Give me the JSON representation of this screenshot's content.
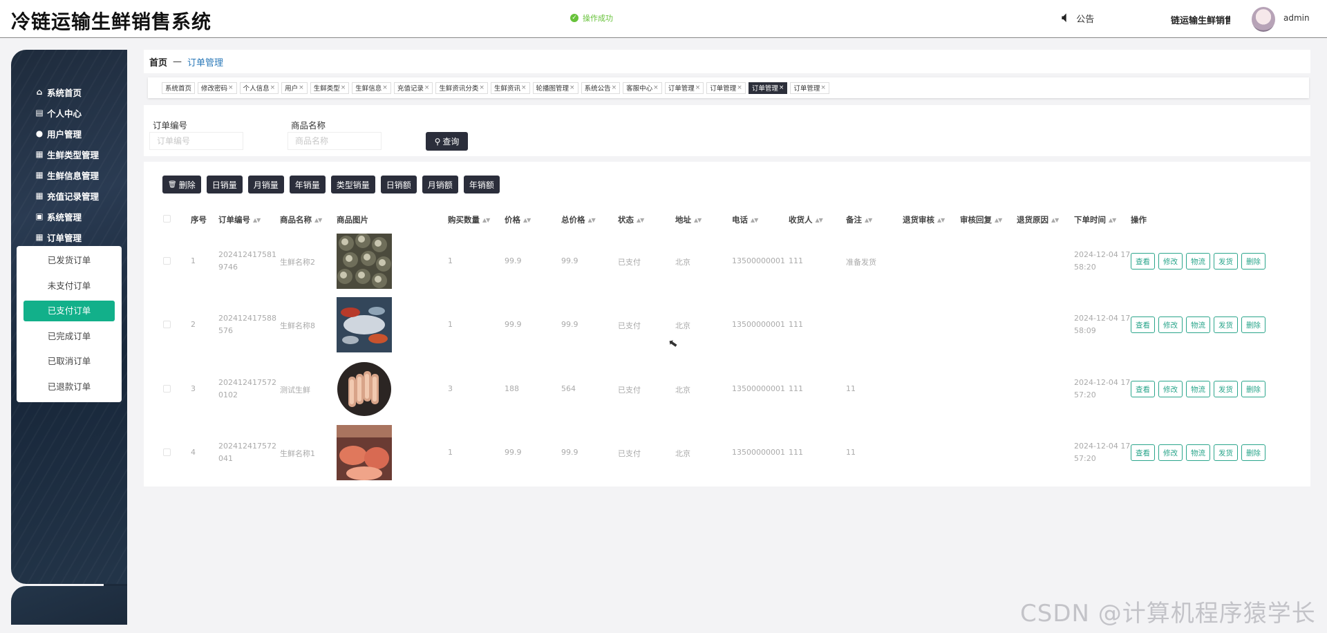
{
  "app": {
    "title": "冷链运输生鲜销售系统",
    "toast": "操作成功",
    "notice_label": "公告",
    "header_sub": "链运输生鲜销售",
    "username": "admin"
  },
  "sidebar": {
    "items": [
      {
        "label": "系统首页",
        "icon": "home-icon",
        "glyph": "⌂"
      },
      {
        "label": "个人中心",
        "icon": "user-card-icon",
        "glyph": "▤"
      },
      {
        "label": "用户管理",
        "icon": "location-pin-icon",
        "glyph": "●"
      },
      {
        "label": "生鲜类型管理",
        "icon": "grid-icon",
        "glyph": "▦"
      },
      {
        "label": "生鲜信息管理",
        "icon": "grid-icon",
        "glyph": "▦"
      },
      {
        "label": "充值记录管理",
        "icon": "grid-icon",
        "glyph": "▦"
      },
      {
        "label": "系统管理",
        "icon": "clipboard-icon",
        "glyph": "▣"
      },
      {
        "label": "订单管理",
        "icon": "grid-icon",
        "glyph": "▦"
      }
    ],
    "submenu": [
      "已发货订单",
      "未支付订单",
      "已支付订单",
      "已完成订单",
      "已取消订单",
      "已退款订单"
    ],
    "active_submenu": "已支付订单"
  },
  "breadcrumb": {
    "home": "首页",
    "sep": "—",
    "current": "订单管理"
  },
  "tabs": [
    {
      "label": "系统首页",
      "closable": false
    },
    {
      "label": "修改密码",
      "closable": true
    },
    {
      "label": "个人信息",
      "closable": true
    },
    {
      "label": "用户",
      "closable": true
    },
    {
      "label": "生鲜类型",
      "closable": true
    },
    {
      "label": "生鲜信息",
      "closable": true
    },
    {
      "label": "充值记录",
      "closable": true
    },
    {
      "label": "生鲜资讯分类",
      "closable": true
    },
    {
      "label": "生鲜资讯",
      "closable": true
    },
    {
      "label": "轮播图管理",
      "closable": true
    },
    {
      "label": "系统公告",
      "closable": true
    },
    {
      "label": "客服中心",
      "closable": true
    },
    {
      "label": "订单管理",
      "closable": true
    },
    {
      "label": "订单管理",
      "closable": true
    },
    {
      "label": "订单管理",
      "closable": true,
      "active": true
    },
    {
      "label": "订单管理",
      "closable": true
    }
  ],
  "search": {
    "order_no_label": "订单编号",
    "order_no_placeholder": "订单编号",
    "product_label": "商品名称",
    "product_placeholder": "商品名称",
    "query_label": "查询"
  },
  "actions": [
    "删除",
    "日销量",
    "月销量",
    "年销量",
    "类型销量",
    "日销额",
    "月销额",
    "年销额"
  ],
  "table": {
    "columns": [
      {
        "key": "seq",
        "label": "序号",
        "sort": false
      },
      {
        "key": "order_no",
        "label": "订单编号",
        "sort": true
      },
      {
        "key": "product",
        "label": "商品名称",
        "sort": true
      },
      {
        "key": "image",
        "label": "商品图片",
        "sort": false
      },
      {
        "key": "qty",
        "label": "购买数量",
        "sort": true
      },
      {
        "key": "price",
        "label": "价格",
        "sort": true
      },
      {
        "key": "total",
        "label": "总价格",
        "sort": true
      },
      {
        "key": "status",
        "label": "状态",
        "sort": true
      },
      {
        "key": "address",
        "label": "地址",
        "sort": true
      },
      {
        "key": "phone",
        "label": "电话",
        "sort": true
      },
      {
        "key": "receiver",
        "label": "收货人",
        "sort": true
      },
      {
        "key": "remark",
        "label": "备注",
        "sort": true
      },
      {
        "key": "refund_review",
        "label": "退货审核",
        "sort": true
      },
      {
        "key": "review_reply",
        "label": "审核回复",
        "sort": true
      },
      {
        "key": "refund_reason",
        "label": "退货原因",
        "sort": true
      },
      {
        "key": "time",
        "label": "下单时间",
        "sort": true
      },
      {
        "key": "ops",
        "label": "操作",
        "sort": false
      }
    ],
    "rows": [
      {
        "seq": "1",
        "order_no": "2024124175819746",
        "product": "生鲜名称2",
        "image": "snails",
        "qty": "1",
        "price": "99.9",
        "total": "99.9",
        "status": "已支付",
        "address": "北京",
        "phone": "13500000001",
        "receiver": "111",
        "remark": "准备发货",
        "time": "2024-12-04 17:58:20"
      },
      {
        "seq": "2",
        "order_no": "202412417588576",
        "product": "生鲜名称8",
        "image": "seafood",
        "qty": "1",
        "price": "99.9",
        "total": "99.9",
        "status": "已支付",
        "address": "北京",
        "phone": "13500000001",
        "receiver": "111",
        "remark": "",
        "time": "2024-12-04 17:58:09"
      },
      {
        "seq": "3",
        "order_no": "2024124175720102",
        "product": "测试生鲜",
        "image": "shrimp",
        "qty": "3",
        "price": "188",
        "total": "564",
        "status": "已支付",
        "address": "北京",
        "phone": "13500000001",
        "receiver": "111",
        "remark": "11",
        "time": "2024-12-04 17:57:20"
      },
      {
        "seq": "4",
        "order_no": "202412417572041",
        "product": "生鲜名称1",
        "image": "meat",
        "qty": "1",
        "price": "99.9",
        "total": "99.9",
        "status": "已支付",
        "address": "北京",
        "phone": "13500000001",
        "receiver": "111",
        "remark": "11",
        "time": "2024-12-04 17:57:20"
      }
    ],
    "row_actions": [
      "查看",
      "修改",
      "物流",
      "发货",
      "删除"
    ]
  },
  "watermark": "CSDN @计算机程序猿学长",
  "colors": {
    "accent": "#12b08a",
    "dark_button": "#2b2e3b",
    "link": "#2a78b8",
    "outline": "#2aa58b"
  }
}
